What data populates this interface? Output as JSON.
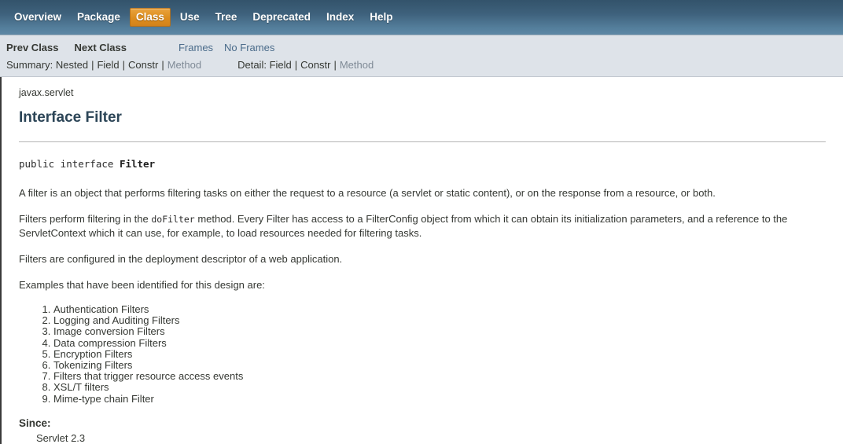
{
  "topnav": {
    "items": [
      {
        "label": "Overview",
        "active": false
      },
      {
        "label": "Package",
        "active": false
      },
      {
        "label": "Class",
        "active": true
      },
      {
        "label": "Use",
        "active": false
      },
      {
        "label": "Tree",
        "active": false
      },
      {
        "label": "Deprecated",
        "active": false
      },
      {
        "label": "Index",
        "active": false
      },
      {
        "label": "Help",
        "active": false
      }
    ],
    "active_bg": "#dd8d1d",
    "bar_color_top": "#33536b",
    "bar_color_bottom": "#5c87a5"
  },
  "subnav": {
    "prev_class": "Prev Class",
    "next_class": "Next Class",
    "frames": "Frames",
    "no_frames": "No Frames",
    "summary_label": "Summary:",
    "summary_items": [
      "Nested",
      "Field",
      "Constr",
      "Method"
    ],
    "summary_muted_index": 3,
    "detail_label": "Detail:",
    "detail_items": [
      "Field",
      "Constr",
      "Method"
    ],
    "detail_muted_index": 2,
    "separator": "|",
    "bg_color": "#dee3e9",
    "link_color": "#4a6b8a"
  },
  "main": {
    "package_name": "javax.servlet",
    "class_title": "Interface Filter",
    "title_color": "#2c4557",
    "declaration": {
      "modifiers": "public interface ",
      "name": "Filter"
    },
    "paragraphs": {
      "p1": "A filter is an object that performs filtering tasks on either the request to a resource (a servlet or static content), or on the response from a resource, or both.",
      "p2_a": "Filters perform filtering in the ",
      "p2_code": "doFilter",
      "p2_b": " method. Every Filter has access to a FilterConfig object from which it can obtain its initialization parameters, and a reference to the ServletContext which it can use, for example, to load resources needed for filtering tasks.",
      "p3": "Filters are configured in the deployment descriptor of a web application.",
      "p4": "Examples that have been identified for this design are:"
    },
    "examples": [
      "Authentication Filters",
      "Logging and Auditing Filters",
      "Image conversion Filters",
      "Data compression Filters",
      "Encryption Filters",
      "Tokenizing Filters",
      "Filters that trigger resource access events",
      "XSL/T filters",
      "Mime-type chain Filter"
    ],
    "since_heading": "Since:",
    "since_value": "Servlet 2.3"
  }
}
